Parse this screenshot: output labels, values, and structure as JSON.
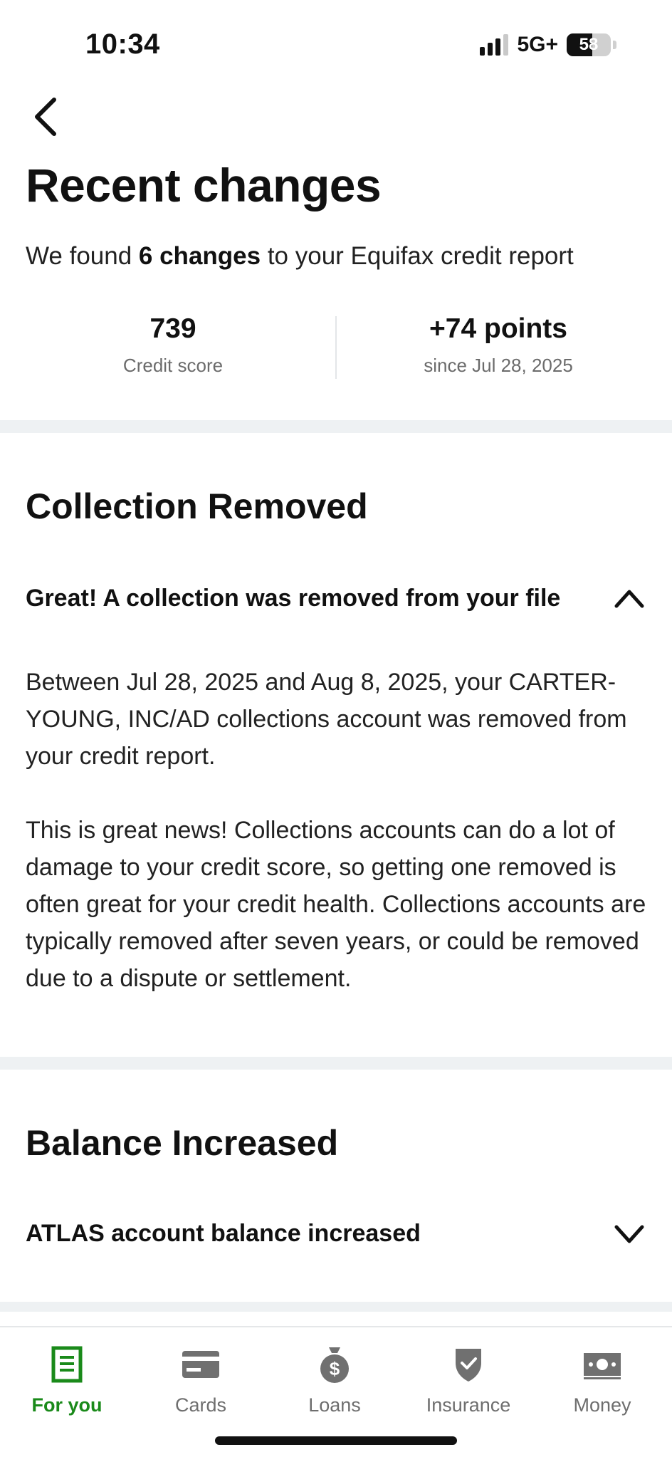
{
  "status_bar": {
    "time": "10:34",
    "network": "5G+",
    "battery_level": "58",
    "battery_fraction": 0.58
  },
  "header": {
    "back_icon": "chevron-left-icon",
    "title": "Recent changes",
    "summary_prefix": "We found ",
    "summary_bold": "6 changes",
    "summary_suffix": " to your Equifax credit report"
  },
  "stats": {
    "score_value": "739",
    "score_label": "Credit score",
    "change_value": "+74 points",
    "change_label": "since Jul 28, 2025"
  },
  "sections": [
    {
      "title": "Collection Removed",
      "row_label": "Great! A collection was removed from your file",
      "expanded": true,
      "toggle_icon": "chevron-up-icon",
      "paragraphs": [
        "Between Jul 28, 2025 and Aug 8, 2025, your CARTER-YOUNG, INC/AD collections account was removed from your credit report.",
        "This is great news! Collections accounts can do a lot of damage to your credit score, so getting one removed is often great for your credit health. Collections accounts are typically removed after seven years, or could be removed due to a dispute or settlement."
      ]
    },
    {
      "title": "Balance Increased",
      "row_label": "ATLAS account balance increased",
      "expanded": false,
      "toggle_icon": "chevron-down-icon"
    }
  ],
  "tabbar": {
    "items": [
      {
        "label": "For you",
        "icon": "document-icon",
        "active": true
      },
      {
        "label": "Cards",
        "icon": "credit-card-icon",
        "active": false
      },
      {
        "label": "Loans",
        "icon": "money-bag-icon",
        "active": false
      },
      {
        "label": "Insurance",
        "icon": "shield-check-icon",
        "active": false
      },
      {
        "label": "Money",
        "icon": "cash-icon",
        "active": false
      }
    ]
  },
  "colors": {
    "accent_green": "#1a8a1a",
    "inactive_icon": "#6e6e6e",
    "separator": "#eef1f3"
  }
}
